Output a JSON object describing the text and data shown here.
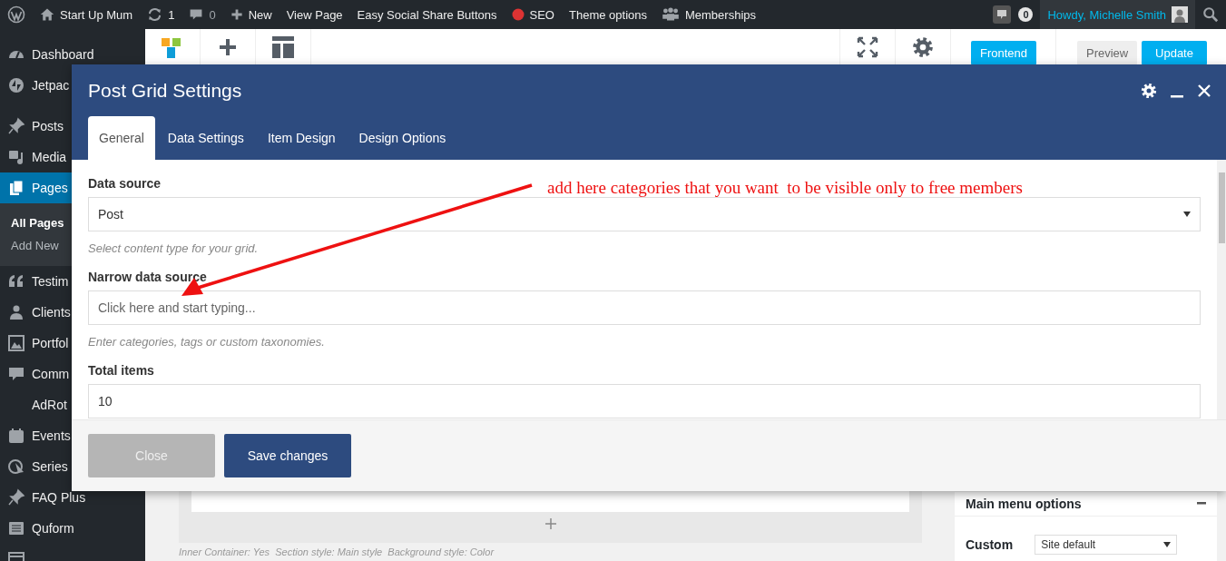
{
  "admin_bar": {
    "items": [
      {
        "kind": "logo"
      },
      {
        "kind": "home",
        "label": "Start Up Mum"
      },
      {
        "kind": "updates",
        "label": "1"
      },
      {
        "kind": "comments",
        "label": "0"
      },
      {
        "kind": "new",
        "label": "New"
      },
      {
        "kind": "text",
        "label": "View Page"
      },
      {
        "kind": "text",
        "label": "Easy Social Share Buttons"
      },
      {
        "kind": "seo",
        "label": "SEO"
      },
      {
        "kind": "text",
        "label": "Theme options"
      },
      {
        "kind": "members",
        "label": "Memberships"
      }
    ],
    "notification_count": "0",
    "greeting": "Howdy, Michelle Smith"
  },
  "sidebar": {
    "groups": [
      [
        {
          "label": "Dashboard",
          "selected": false
        },
        {
          "label": "Jetpac",
          "selected": false
        }
      ],
      [
        {
          "label": "Posts",
          "selected": false
        },
        {
          "label": "Media",
          "selected": false
        },
        {
          "label": "Pages",
          "selected": true,
          "children": [
            {
              "label": "All Pages",
              "selected": true
            },
            {
              "label": "Add New",
              "selected": false
            }
          ]
        },
        {
          "label": "Testim",
          "selected": false
        },
        {
          "label": "Clients",
          "selected": false
        },
        {
          "label": "Portfol",
          "selected": false
        },
        {
          "label": "Comm",
          "selected": false
        },
        {
          "label": "AdRot",
          "selected": false
        },
        {
          "label": "Events",
          "selected": false
        },
        {
          "label": "Series",
          "selected": false
        },
        {
          "label": "FAQ Plus",
          "selected": false
        },
        {
          "label": "Quform",
          "selected": false
        },
        {
          "selected": false
        }
      ]
    ]
  },
  "editor": {
    "buttons": [
      {
        "kind": "primary",
        "label": "Frontend"
      },
      {
        "kind": "secondary",
        "label": "Preview"
      },
      {
        "kind": "primary",
        "label": "Update"
      }
    ],
    "section_info": "Inner Container: Yes  Section style: Main style  Background style: Color",
    "panel": {
      "title": "Main menu options",
      "option_label": "Custom",
      "option_value": "Site default"
    }
  },
  "modal": {
    "title": "Post Grid Settings",
    "tabs": [
      {
        "label": "General",
        "selected": true
      },
      {
        "label": "Data Settings",
        "selected": false
      },
      {
        "label": "Item Design",
        "selected": false
      },
      {
        "label": "Design Options",
        "selected": false
      }
    ],
    "fields": [
      {
        "kind": "select",
        "label": "Data source",
        "value": "Post",
        "hint": "Select content type for your grid."
      },
      {
        "kind": "text",
        "label": "Narrow data source",
        "placeholder": "Click here and start typing...",
        "hint": "Enter categories, tags or custom taxonomies."
      },
      {
        "kind": "text",
        "label": "Total items",
        "value": "10"
      }
    ],
    "buttons": [
      {
        "kind": "secondary",
        "label": "Close"
      },
      {
        "kind": "primary",
        "label": "Save changes"
      }
    ]
  },
  "annotation": {
    "text": "add here categories that you want  to be visible only to free members"
  }
}
